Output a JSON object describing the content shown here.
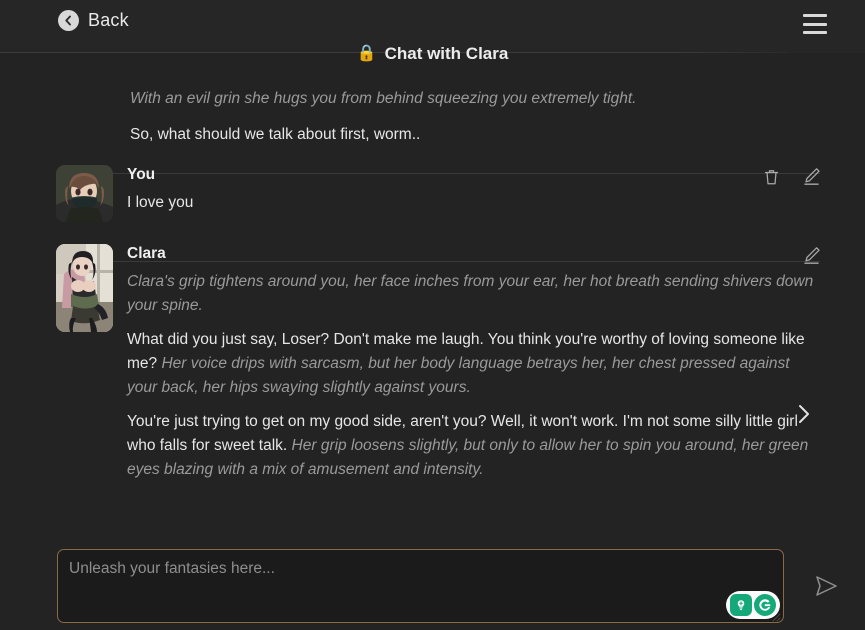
{
  "header": {
    "back_label": "Back",
    "back_icon": "chevron-left-circle-icon",
    "menu_icon": "hamburger-menu-icon"
  },
  "chat": {
    "lock_icon": "🔒",
    "title": "Chat with Clara"
  },
  "intro": {
    "narration": "With an evil grin she hugs you from behind squeezing you extremely tight.",
    "dialogue": "So, what should we talk about first, worm.."
  },
  "messages": [
    {
      "name": "You",
      "avatar_alt": "anime-girl-with-black-face-mask-avatar",
      "text": "I love you",
      "actions": [
        "delete-icon",
        "edit-icon"
      ]
    },
    {
      "name": "Clara",
      "avatar_alt": "anime-girl-by-window-avatar",
      "narration_1": "Clara's grip tightens around you, her face inches from your ear, her hot breath sending shivers down your spine.",
      "dialogue_1": "What did you just say, Loser? Don't make me laugh. You think you're worthy of loving someone like me?",
      "narration_2": "Her voice drips with sarcasm, but her body language betrays her, her chest pressed against your back, her hips swaying slightly against yours.",
      "dialogue_2": "You're just trying to get on my good side, aren't you? Well, it won't work. I'm not some silly little girl who falls for sweet talk.",
      "narration_3": "Her grip loosens slightly, but only to allow her to spin you around, her green eyes blazing with a mix of amusement and intensity.",
      "actions": [
        "edit-icon"
      ],
      "next_swipe_icon": "chevron-right-icon"
    }
  ],
  "composer": {
    "placeholder": "Unleash your fantasies here...",
    "send_icon": "send-arrow-icon",
    "grammarly_icons": [
      "grammarly-suggestion-bulb-icon",
      "grammarly-logo-icon"
    ]
  },
  "colors": {
    "background": "#232323",
    "header_bg": "#262626",
    "input_border": "#8a6a46",
    "accent_teal": "#15a97a",
    "lock_yellow": "#e8c252",
    "text_primary": "#e6e6e6",
    "text_muted": "#9a9a9a"
  }
}
